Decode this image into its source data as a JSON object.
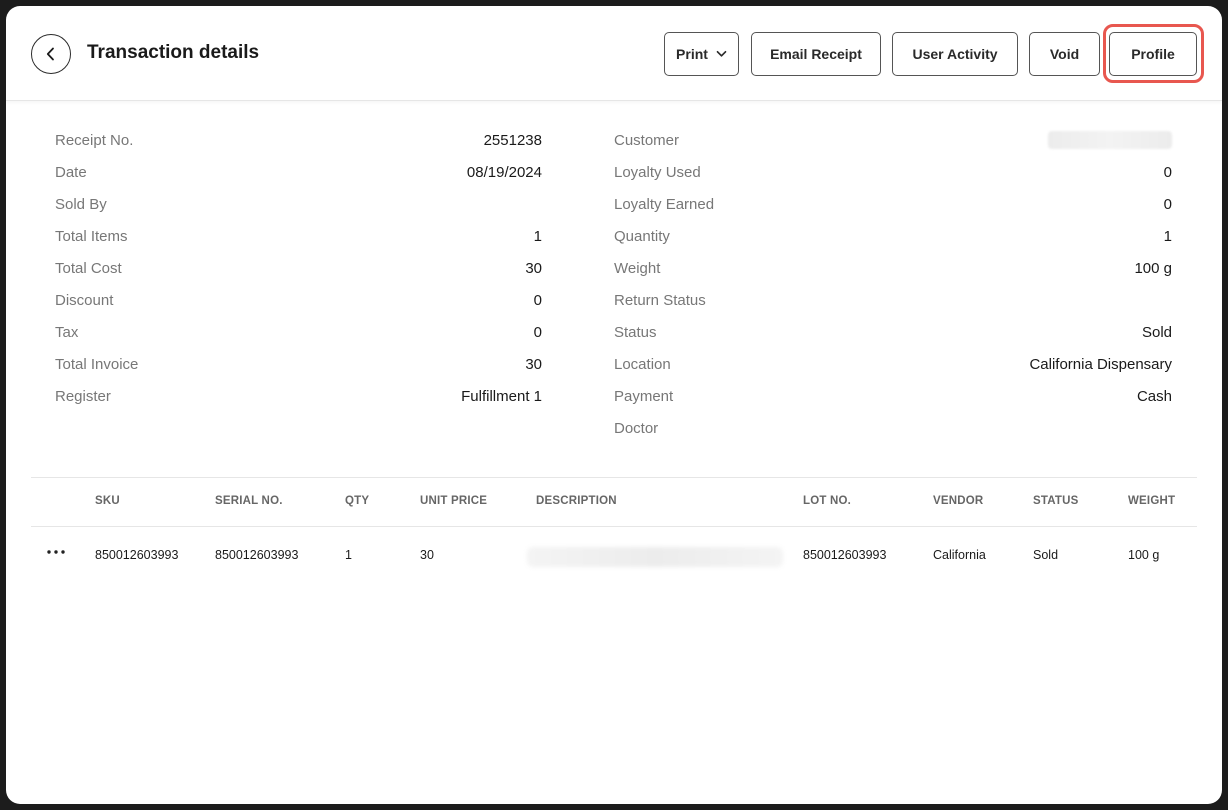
{
  "header": {
    "title": "Transaction details",
    "buttons": {
      "print": "Print",
      "email_receipt": "Email Receipt",
      "user_activity": "User Activity",
      "void": "Void",
      "profile": "Profile"
    },
    "highlight_color": "#e8574f"
  },
  "details": {
    "left": [
      {
        "label": "Receipt No.",
        "value": "2551238"
      },
      {
        "label": "Date",
        "value": "08/19/2024"
      },
      {
        "label": "Sold By",
        "value": ""
      },
      {
        "label": "Total Items",
        "value": "1"
      },
      {
        "label": "Total Cost",
        "value": "30"
      },
      {
        "label": "Discount",
        "value": "0"
      },
      {
        "label": "Tax",
        "value": "0"
      },
      {
        "label": "Total Invoice",
        "value": "30"
      },
      {
        "label": "Register",
        "value": "Fulfillment 1"
      }
    ],
    "right": [
      {
        "label": "Customer",
        "value": ""
      },
      {
        "label": "Loyalty Used",
        "value": "0"
      },
      {
        "label": "Loyalty Earned",
        "value": "0"
      },
      {
        "label": "Quantity",
        "value": "1"
      },
      {
        "label": "Weight",
        "value": "100 g"
      },
      {
        "label": "Return Status",
        "value": ""
      },
      {
        "label": "Status",
        "value": "Sold"
      },
      {
        "label": "Location",
        "value": "California Dispensary"
      },
      {
        "label": "Payment",
        "value": "Cash"
      },
      {
        "label": "Doctor",
        "value": ""
      }
    ]
  },
  "table": {
    "columns": {
      "sku": "SKU",
      "serial_no": "SERIAL NO.",
      "qty": "QTY",
      "unit_price": "UNIT PRICE",
      "description": "DESCRIPTION",
      "lot_no": "LOT NO.",
      "vendor": "VENDOR",
      "status": "STATUS",
      "weight": "WEIGHT"
    },
    "rows": [
      {
        "sku": "850012603993",
        "serial_no": "850012603993",
        "qty": "1",
        "unit_price": "30",
        "description": "",
        "lot_no": "850012603993",
        "vendor": "California",
        "status": "Sold",
        "weight": "100 g"
      }
    ]
  },
  "icons": {
    "back": "chevron-left-icon",
    "print_caret": "chevron-down-icon",
    "row_menu": "more-horizontal-icon"
  }
}
